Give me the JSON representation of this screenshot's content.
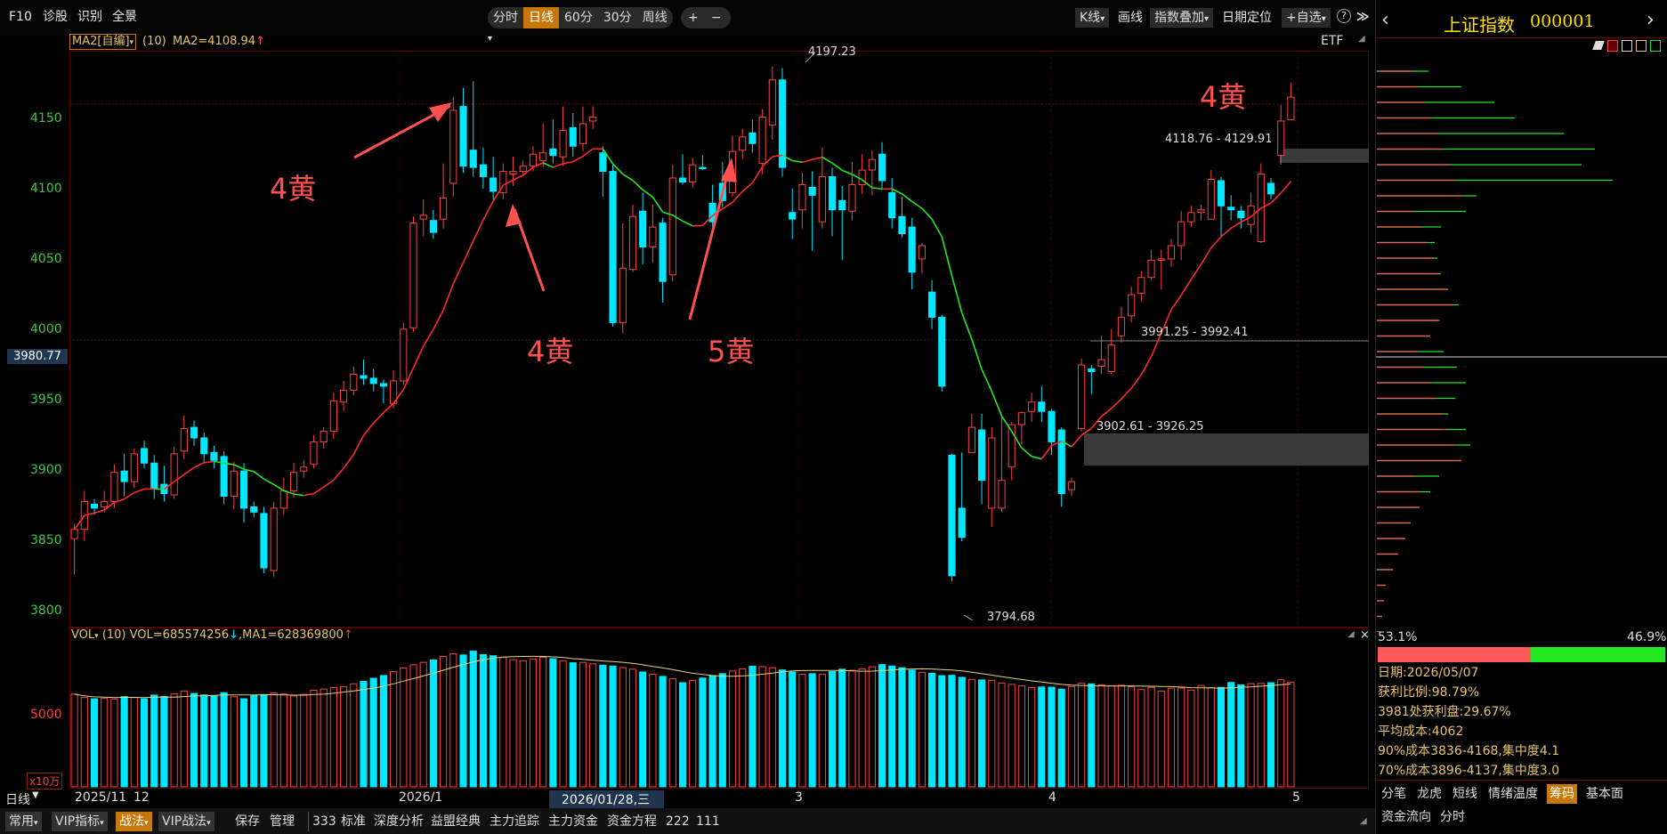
{
  "toolbar": {
    "f10": "F10",
    "diag": "诊股",
    "recog": "识别",
    "panorama": "全景",
    "periods": [
      "分时",
      "日线",
      "60分",
      "30分",
      "周线"
    ],
    "period_active": "日线",
    "zoom_in": "+",
    "zoom_out": "−",
    "kline": "K线",
    "draw": "画线",
    "overlay": "指数叠加",
    "datepos": "日期定位",
    "addfav": "+自选",
    "help": "?",
    "collapse": "≫"
  },
  "main_indicator": {
    "label": "MA2[自编]",
    "param": "(10)",
    "ma_text": "MA2=4108.94",
    "arrow": "↑",
    "etf": "ETF"
  },
  "price_axis": {
    "labels": [
      "4150",
      "4100",
      "4050",
      "4000",
      "3950",
      "3900",
      "3850",
      "3800"
    ],
    "current": "3980.77"
  },
  "price_annotations": {
    "high": "4197.23",
    "low": "3794.68",
    "zone1": "4118.76 - 4129.91",
    "zone2": "3991.25 - 3992.41",
    "zone3": "3902.61 - 3926.25"
  },
  "annotations": [
    "4黄",
    "4黄",
    "5黄",
    "4黄"
  ],
  "volume": {
    "label": "VOL",
    "param": "(10)",
    "vol_text": "VOL=685574256",
    "vol_arrow": "↓",
    "ma_text": ",MA1=628369800",
    "ma_arrow": "↑",
    "axis": "5000",
    "unit": "x10万"
  },
  "date_axis": {
    "period": "日线",
    "labels": [
      "2025/11",
      "12",
      "2026/1",
      "3",
      "4",
      "5"
    ],
    "cursor": "2026/01/28,三"
  },
  "bottom_tabs": [
    "常用",
    "VIP指标",
    "战法",
    "VIP战法",
    "保存",
    "管理",
    "333",
    "标准",
    "深度分析",
    "益盟经典",
    "主力追踪",
    "主力资金",
    "资金方程",
    "222",
    "111"
  ],
  "right_panel": {
    "title": "上证指数",
    "code": "000001",
    "profit_pct": "53.1%",
    "loss_pct": "46.9%",
    "info": [
      "日期:2026/05/07",
      "获利比例:98.79%",
      "3981处获利盘:29.67%",
      "平均成本:4062",
      "90%成本3836-4168,集中度4.1",
      "70%成本3896-4137,集中度3.0"
    ],
    "tabs": [
      "分笔",
      "龙虎",
      "短线",
      "情绪温度",
      "筹码",
      "基本面",
      "资金流向",
      "分时"
    ],
    "tab_active": "筹码"
  },
  "colors": {
    "up": "#ff4040",
    "down": "#00e8ff",
    "ma_up": "#ff2a2a",
    "ma_down": "#22e822",
    "axis_text": "#3ec83e",
    "accent": "#c8780a",
    "annot": "#ff5050"
  },
  "chart_data": {
    "type": "candlestick",
    "ylim": [
      3775,
      4210
    ],
    "candles": [
      [
        3842,
        3849,
        3853,
        3815
      ],
      [
        3849,
        3870,
        3878,
        3840
      ],
      [
        3868,
        3865,
        3872,
        3860
      ],
      [
        3866,
        3870,
        3878,
        3862
      ],
      [
        3870,
        3892,
        3898,
        3865
      ],
      [
        3893,
        3885,
        3906,
        3874
      ],
      [
        3885,
        3906,
        3910,
        3880
      ],
      [
        3910,
        3899,
        3916,
        3895
      ],
      [
        3899,
        3880,
        3905,
        3872
      ],
      [
        3883,
        3876,
        3897,
        3870
      ],
      [
        3875,
        3906,
        3911,
        3872
      ],
      [
        3908,
        3925,
        3935,
        3902
      ],
      [
        3926,
        3918,
        3931,
        3912
      ],
      [
        3918,
        3906,
        3922,
        3899
      ],
      [
        3907,
        3901,
        3912,
        3895
      ],
      [
        3904,
        3874,
        3908,
        3868
      ],
      [
        3874,
        3893,
        3900,
        3864
      ],
      [
        3893,
        3865,
        3899,
        3854
      ],
      [
        3866,
        3862,
        3870,
        3858
      ],
      [
        3861,
        3820,
        3866,
        3816
      ],
      [
        3818,
        3865,
        3870,
        3813
      ],
      [
        3865,
        3878,
        3888,
        3860
      ],
      [
        3878,
        3892,
        3899,
        3873
      ],
      [
        3893,
        3896,
        3901,
        3888
      ],
      [
        3898,
        3915,
        3920,
        3895
      ],
      [
        3915,
        3923,
        3926,
        3910
      ],
      [
        3923,
        3946,
        3952,
        3917
      ],
      [
        3945,
        3954,
        3961,
        3938
      ],
      [
        3954,
        3966,
        3972,
        3950
      ],
      [
        3965,
        3963,
        3977,
        3958
      ],
      [
        3963,
        3959,
        3970,
        3953
      ],
      [
        3959,
        3957,
        3962,
        3944
      ],
      [
        3944,
        3961,
        3969,
        3940
      ],
      [
        3961,
        4000,
        4005,
        3958
      ],
      [
        4001,
        4080,
        4085,
        3998
      ],
      [
        4083,
        4086,
        4098,
        4070
      ],
      [
        4082,
        4073,
        4090,
        4068
      ],
      [
        4083,
        4099,
        4125,
        4076
      ],
      [
        4110,
        4165,
        4175,
        4100
      ],
      [
        4168,
        4123,
        4182,
        4118
      ],
      [
        4135,
        4122,
        4187,
        4115
      ],
      [
        4124,
        4115,
        4137,
        4106
      ],
      [
        4114,
        4104,
        4130,
        4098
      ],
      [
        4103,
        4119,
        4125,
        4098
      ],
      [
        4117,
        4119,
        4130,
        4108
      ],
      [
        4119,
        4123,
        4127,
        4116
      ],
      [
        4123,
        4132,
        4138,
        4119
      ],
      [
        4127,
        4133,
        4155,
        4122
      ],
      [
        4136,
        4131,
        4158,
        4125
      ],
      [
        4130,
        4150,
        4168,
        4123
      ],
      [
        4152,
        4138,
        4163,
        4130
      ],
      [
        4140,
        4155,
        4168,
        4134
      ],
      [
        4157,
        4160,
        4168,
        4151
      ],
      [
        4133,
        4119,
        4138,
        4100
      ],
      [
        4119,
        4005,
        4124,
        4002
      ],
      [
        4005,
        4046,
        4080,
        3997
      ],
      [
        4045,
        4085,
        4094,
        4043
      ],
      [
        4089,
        4062,
        4103,
        4049
      ],
      [
        4062,
        4077,
        4094,
        4050
      ],
      [
        4080,
        4036,
        4084,
        4020
      ],
      [
        4041,
        4114,
        4124,
        4036
      ],
      [
        4114,
        4111,
        4132,
        4109
      ],
      [
        4111,
        4124,
        4129,
        4107
      ],
      [
        4122,
        4121,
        4131,
        4120
      ],
      [
        4095,
        4081,
        4109,
        4077
      ],
      [
        4110,
        4097,
        4126,
        4092
      ],
      [
        4103,
        4134,
        4146,
        4100
      ],
      [
        4135,
        4145,
        4151,
        4128
      ],
      [
        4148,
        4140,
        4158,
        4133
      ],
      [
        4125,
        4160,
        4166,
        4117
      ],
      [
        4154,
        4188,
        4198,
        4143
      ],
      [
        4188,
        4122,
        4197,
        4115
      ],
      [
        4088,
        4083,
        4106,
        4068
      ],
      [
        4090,
        4109,
        4118,
        4076
      ],
      [
        4107,
        4101,
        4119,
        4059
      ],
      [
        4081,
        4115,
        4137,
        4076
      ],
      [
        4115,
        4090,
        4122,
        4070
      ],
      [
        4097,
        4090,
        4108,
        4052
      ],
      [
        4089,
        4109,
        4126,
        4082
      ],
      [
        4109,
        4120,
        4132,
        4102
      ],
      [
        4120,
        4128,
        4135,
        4101
      ],
      [
        4132,
        4112,
        4141,
        4105
      ],
      [
        4103,
        4084,
        4114,
        4076
      ],
      [
        4085,
        4072,
        4100,
        4069
      ],
      [
        4077,
        4043,
        4084,
        4030
      ],
      [
        4053,
        4063,
        4065,
        4042
      ],
      [
        4028,
        4009,
        4037,
        4000
      ],
      [
        4009,
        3957,
        4011,
        3953
      ],
      [
        3905,
        3814,
        3906,
        3810
      ],
      [
        3865,
        3843,
        3907,
        3840
      ],
      [
        3907,
        3926,
        3936,
        3908
      ],
      [
        3924,
        3886,
        3936,
        3868
      ],
      [
        3865,
        3918,
        3926,
        3851
      ],
      [
        3865,
        3886,
        3934,
        3862
      ],
      [
        3896,
        3928,
        3930,
        3886
      ],
      [
        3928,
        3937,
        3938,
        3913
      ],
      [
        3938,
        3945,
        3952,
        3930
      ],
      [
        3945,
        3938,
        3957,
        3930
      ],
      [
        3938,
        3915,
        3940,
        3905
      ],
      [
        3924,
        3876,
        3926,
        3866
      ],
      [
        3879,
        3885,
        3888,
        3874
      ],
      [
        3925,
        3973,
        3978,
        3923
      ],
      [
        3970,
        3968,
        3973,
        3951
      ],
      [
        3972,
        3977,
        3995,
        3966
      ],
      [
        3968,
        3988,
        4000,
        3966
      ],
      [
        3995,
        4009,
        4017,
        3990
      ],
      [
        4010,
        4026,
        4032,
        4005
      ],
      [
        4027,
        4039,
        4044,
        4021
      ],
      [
        4039,
        4052,
        4060,
        4037
      ],
      [
        4052,
        4053,
        4060,
        4030
      ],
      [
        4053,
        4063,
        4068,
        4047
      ],
      [
        4063,
        4081,
        4089,
        4052
      ],
      [
        4081,
        4088,
        4093,
        4077
      ],
      [
        4088,
        4090,
        4094,
        4082
      ],
      [
        4083,
        4113,
        4120,
        4084
      ],
      [
        4112,
        4093,
        4115,
        4070
      ],
      [
        4092,
        4090,
        4101,
        4082
      ],
      [
        4089,
        4084,
        4093,
        4076
      ],
      [
        4079,
        4093,
        4103,
        4072
      ],
      [
        4066,
        4117,
        4125,
        4065
      ],
      [
        4110,
        4102,
        4114,
        4098
      ],
      [
        4131,
        4157,
        4169,
        4124
      ],
      [
        4158,
        4175,
        4186,
        4161
      ]
    ],
    "ma_period": 10,
    "volume": [
      5010,
      4830,
      4760,
      4780,
      4750,
      4880,
      4830,
      4760,
      4960,
      4890,
      5030,
      5180,
      5050,
      4970,
      4910,
      5090,
      4870,
      4760,
      4950,
      4990,
      5080,
      5020,
      4920,
      5000,
      5220,
      5290,
      5370,
      5420,
      5570,
      5700,
      5870,
      6020,
      6230,
      6430,
      6600,
      6730,
      6860,
      7050,
      7190,
      7130,
      7340,
      7150,
      7090,
      7000,
      6880,
      6820,
      6920,
      7000,
      6930,
      6820,
      6710,
      6730,
      6650,
      6580,
      6530,
      6450,
      6360,
      6210,
      6090,
      5970,
      5850,
      5630,
      5750,
      5880,
      6010,
      6120,
      6260,
      6380,
      6520,
      6500,
      6440,
      6320,
      6210,
      6090,
      6120,
      6080,
      6230,
      6360,
      6300,
      6370,
      6490,
      6610,
      6530,
      6440,
      6310,
      6190,
      6140,
      6010,
      6030,
      5920,
      5810,
      5780,
      5760,
      5610,
      5540,
      5460,
      5370,
      5400,
      5390,
      5280,
      5420,
      5600,
      5570,
      5520,
      5470,
      5490,
      5410,
      5260,
      5380,
      5180,
      5330,
      5340,
      5230,
      5480,
      5360,
      5380,
      5640,
      5510,
      5580,
      5590,
      5630,
      5790,
      5660
    ]
  }
}
